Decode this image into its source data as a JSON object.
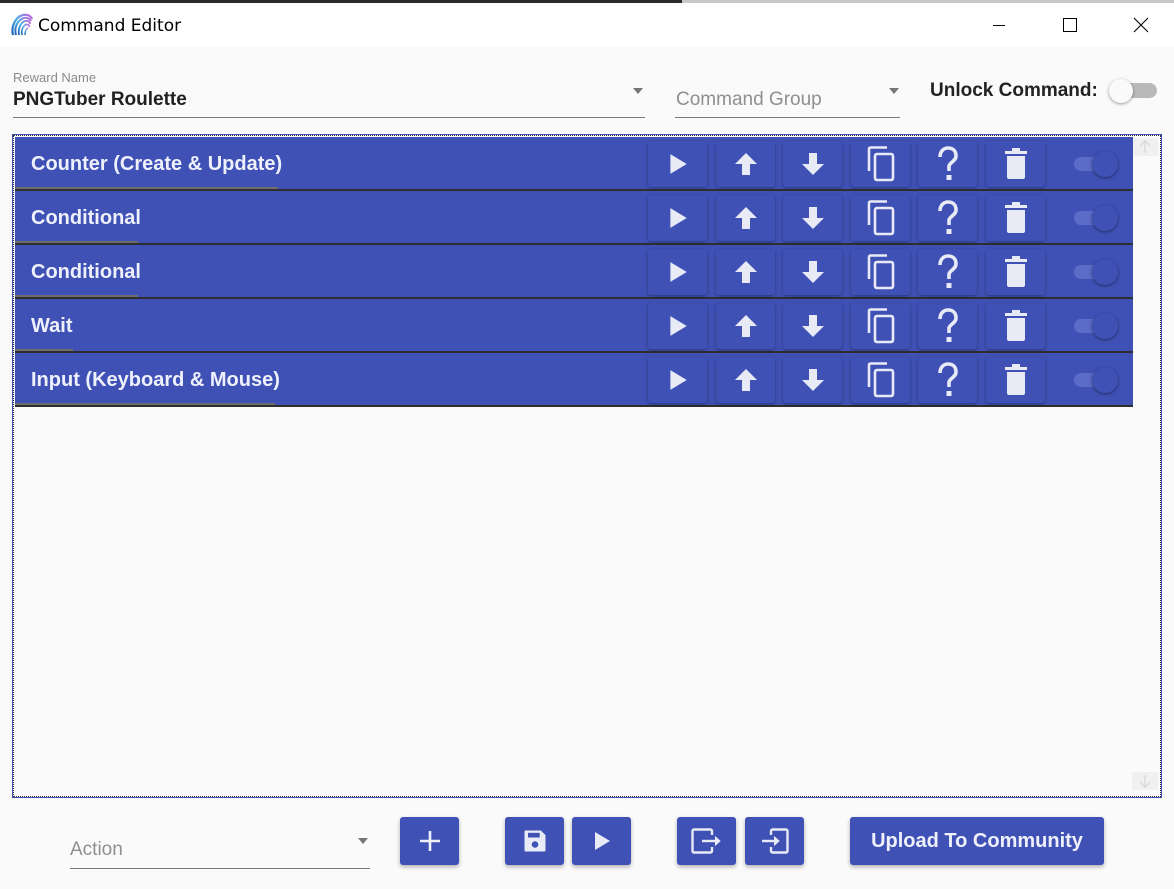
{
  "window": {
    "title": "Command Editor",
    "controls": [
      "minimize",
      "maximize",
      "close"
    ]
  },
  "header": {
    "reward_name": {
      "label": "Reward Name",
      "value": "PNGTuber Roulette"
    },
    "command_group": {
      "placeholder": "Command Group",
      "value": ""
    },
    "unlock_command": {
      "label": "Unlock Command:",
      "enabled": false
    }
  },
  "colors": {
    "accent": "#3f51b5",
    "row_text": "#eef0fb",
    "background": "#fafafa"
  },
  "actions": [
    {
      "title": "Counter (Create & Update)",
      "enabled": true
    },
    {
      "title": "Conditional",
      "enabled": true
    },
    {
      "title": "Conditional",
      "enabled": true
    },
    {
      "title": "Wait",
      "enabled": true
    },
    {
      "title": "Input (Keyboard & Mouse)",
      "enabled": true
    }
  ],
  "row_buttons": [
    "play-icon",
    "arrow-up-icon",
    "arrow-down-icon",
    "copy-icon",
    "help-icon",
    "delete-icon"
  ],
  "footer": {
    "action_select": {
      "placeholder": "Action",
      "value": ""
    },
    "add_tooltip": "+",
    "upload_label": "Upload To Community"
  }
}
